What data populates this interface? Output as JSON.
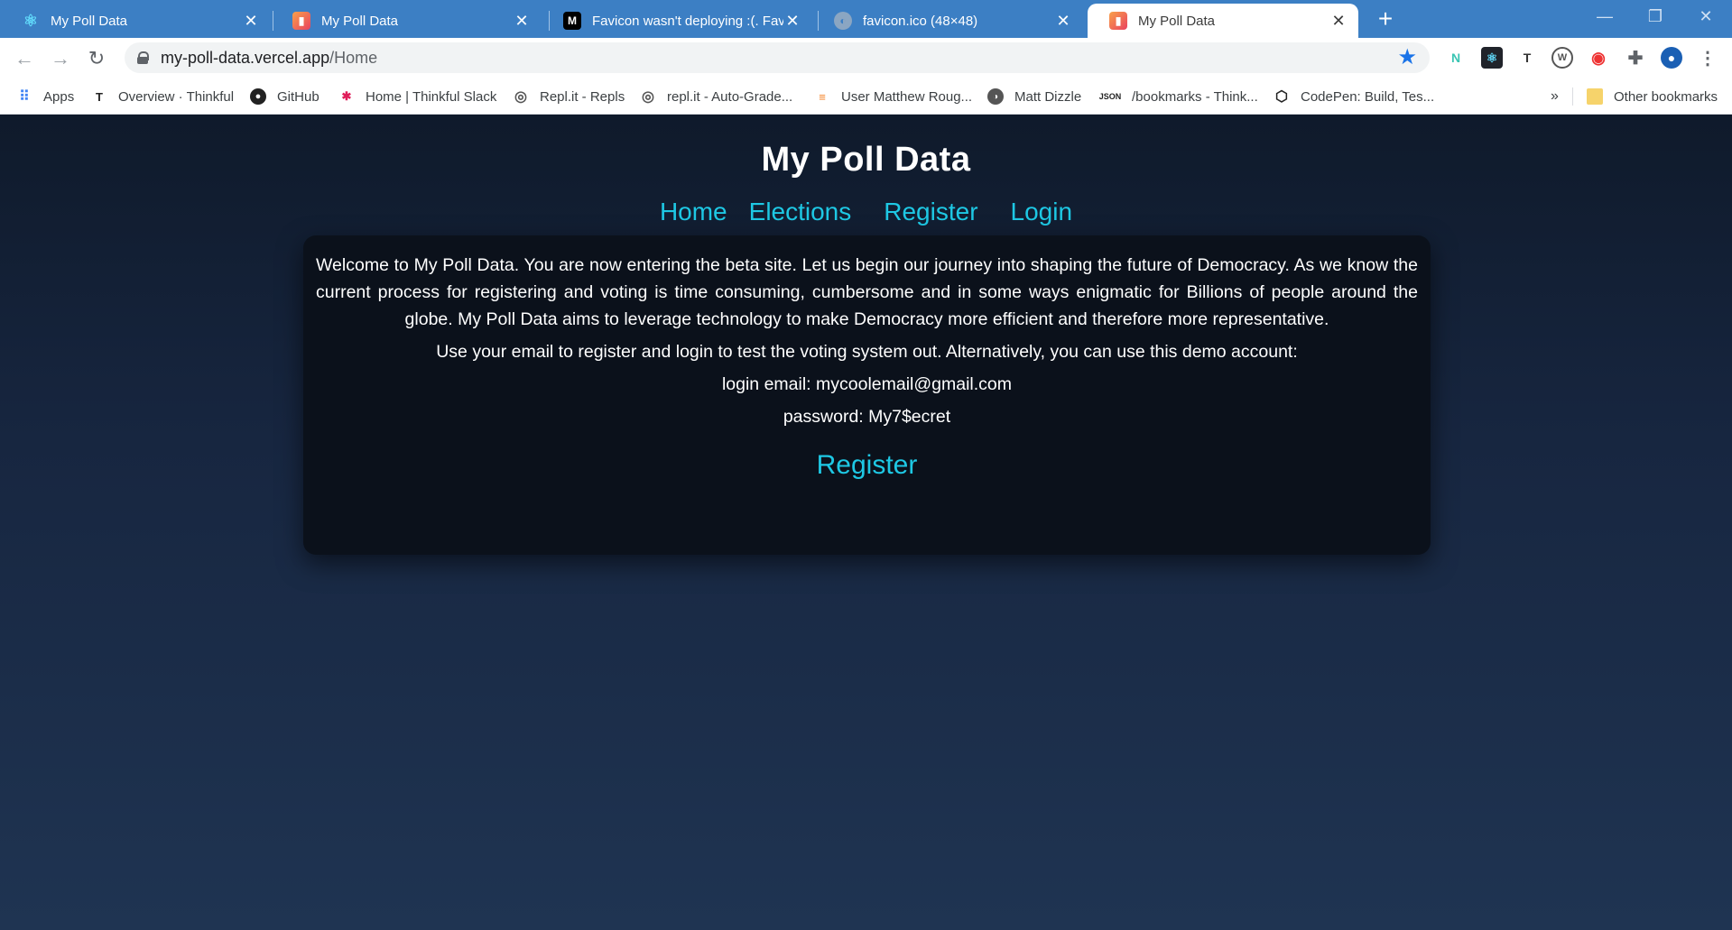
{
  "browser": {
    "tabs": [
      {
        "title": "My Poll Data",
        "favicon": "react-icon",
        "active": false
      },
      {
        "title": "My Poll Data",
        "favicon": "poll-data-icon",
        "active": false
      },
      {
        "title": "Favicon wasn't deploying :(. Favic",
        "favicon": "medium-icon",
        "active": false
      },
      {
        "title": "favicon.ico (48×48)",
        "favicon": "globe-icon",
        "active": false
      },
      {
        "title": "My Poll Data",
        "favicon": "poll-data-icon",
        "active": true
      }
    ],
    "url_host": "my-poll-data.vercel.app",
    "url_path": "/Home",
    "bookmarks": [
      {
        "label": "Apps",
        "icon": "apps-grid-icon"
      },
      {
        "label": "Overview · Thinkful",
        "icon": "thinkful-icon"
      },
      {
        "label": "GitHub",
        "icon": "github-icon"
      },
      {
        "label": "Home | Thinkful Slack",
        "icon": "slack-icon"
      },
      {
        "label": "Repl.it - Repls",
        "icon": "replit-icon"
      },
      {
        "label": "repl.it - Auto-Grade...",
        "icon": "replit-icon"
      },
      {
        "label": "User Matthew Roug...",
        "icon": "stackoverflow-icon"
      },
      {
        "label": "Matt Dizzle",
        "icon": "globe-icon"
      },
      {
        "label": "/bookmarks - Think...",
        "icon": "json-icon"
      },
      {
        "label": "CodePen: Build, Tes...",
        "icon": "codepen-icon"
      }
    ],
    "bookmarks_overflow": "»",
    "other_bookmarks": "Other bookmarks",
    "colors": {
      "tabbar": "#3c7fc4",
      "accent": "#1ec8e4"
    }
  },
  "site": {
    "title": "My Poll Data",
    "nav": [
      "Home",
      "Elections",
      "Register",
      "Login"
    ],
    "intro": "Welcome to My Poll Data. You are now entering the beta site. Let us begin our journey into shaping the future of Democracy. As we know the current process for registering and voting is time consuming, cumbersome and in some ways enigmatic for Billions of people around the globe. My Poll Data aims to leverage technology to make Democracy more efficient and therefore more representative.",
    "instructions": "Use your email to register and login to test the voting system out. Alternatively, you can use this demo account:",
    "demo_email": "login email: mycoolemail@gmail.com",
    "demo_password": "password: My7$ecret",
    "register_label": "Register"
  }
}
